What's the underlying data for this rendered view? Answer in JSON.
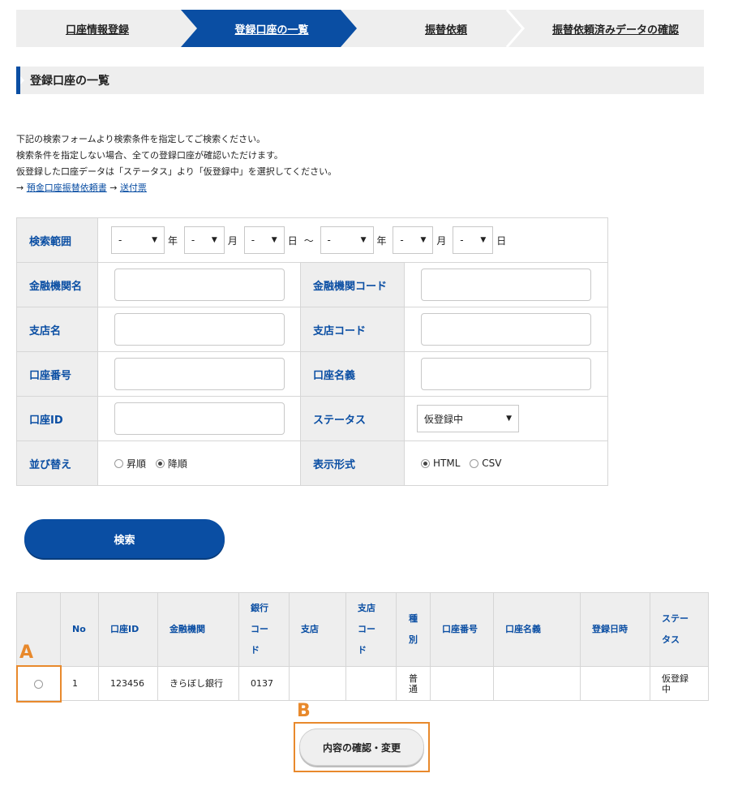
{
  "steps": [
    {
      "label": "口座情報登録"
    },
    {
      "label": "登録口座の一覧"
    },
    {
      "label": "振替依頼"
    },
    {
      "label": "振替依頼済みデータの確認"
    }
  ],
  "section_title": "登録口座の一覧",
  "intro": {
    "line1": "下記の検索フォームより検索条件を指定してご検索ください。",
    "line2": "検索条件を指定しない場合、全ての登録口座が確認いただけます。",
    "line3": "仮登録した口座データは「ステータス」より「仮登録中」を選択してください。",
    "arrow": "→",
    "link1": "預金口座振替依頼書",
    "link2": "送付票"
  },
  "form": {
    "range_label": "検索範囲",
    "select_dash": "-",
    "year": "年",
    "month": "月",
    "day": "日",
    "tilde": "～",
    "bank_name_label": "金融機関名",
    "bank_code_label": "金融機関コード",
    "branch_name_label": "支店名",
    "branch_code_label": "支店コード",
    "account_number_label": "口座番号",
    "account_holder_label": "口座名義",
    "account_id_label": "口座ID",
    "status_label": "ステータス",
    "status_value": "仮登録中",
    "sort_label": "並び替え",
    "sort_asc": "昇順",
    "sort_desc": "降順",
    "format_label": "表示形式",
    "format_html": "HTML",
    "format_csv": "CSV"
  },
  "search_button": "検索",
  "results": {
    "headers": {
      "no": "No",
      "account_id": "口座ID",
      "bank": "金融機関",
      "bank_code_1": "銀行",
      "bank_code_2": "コー",
      "bank_code_3": "ド",
      "branch": "支店",
      "branch_code_1": "支店",
      "branch_code_2": "コー",
      "branch_code_3": "ド",
      "type_1": "種",
      "type_2": "別",
      "account_number": "口座番号",
      "account_holder": "口座名義",
      "registered_at": "登録日時",
      "status_1": "ステー",
      "status_2": "タス"
    },
    "rows": [
      {
        "no": "1",
        "account_id": "123456",
        "bank": "きらぼし銀行",
        "bank_code": "0137",
        "branch": "",
        "branch_code": "",
        "type_1": "普",
        "type_2": "通",
        "account_number": "",
        "account_holder": "",
        "registered_at": "",
        "status_1": "仮登録",
        "status_2": "中"
      }
    ]
  },
  "annotations": {
    "a": "A",
    "b": "B"
  },
  "confirm_button": "内容の確認・変更",
  "colors": {
    "accent": "#0a4ea3",
    "annotation": "#e8892c",
    "panel": "#eeeeee"
  }
}
